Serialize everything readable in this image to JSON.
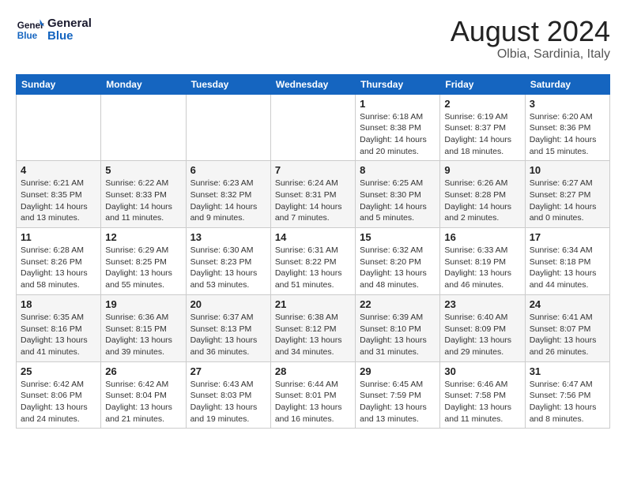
{
  "header": {
    "logo_line1": "General",
    "logo_line2": "Blue",
    "main_title": "August 2024",
    "subtitle": "Olbia, Sardinia, Italy"
  },
  "calendar": {
    "columns": [
      "Sunday",
      "Monday",
      "Tuesday",
      "Wednesday",
      "Thursday",
      "Friday",
      "Saturday"
    ],
    "rows": [
      [
        {
          "day": "",
          "info": ""
        },
        {
          "day": "",
          "info": ""
        },
        {
          "day": "",
          "info": ""
        },
        {
          "day": "",
          "info": ""
        },
        {
          "day": "1",
          "info": "Sunrise: 6:18 AM\nSunset: 8:38 PM\nDaylight: 14 hours and 20 minutes."
        },
        {
          "day": "2",
          "info": "Sunrise: 6:19 AM\nSunset: 8:37 PM\nDaylight: 14 hours and 18 minutes."
        },
        {
          "day": "3",
          "info": "Sunrise: 6:20 AM\nSunset: 8:36 PM\nDaylight: 14 hours and 15 minutes."
        }
      ],
      [
        {
          "day": "4",
          "info": "Sunrise: 6:21 AM\nSunset: 8:35 PM\nDaylight: 14 hours and 13 minutes."
        },
        {
          "day": "5",
          "info": "Sunrise: 6:22 AM\nSunset: 8:33 PM\nDaylight: 14 hours and 11 minutes."
        },
        {
          "day": "6",
          "info": "Sunrise: 6:23 AM\nSunset: 8:32 PM\nDaylight: 14 hours and 9 minutes."
        },
        {
          "day": "7",
          "info": "Sunrise: 6:24 AM\nSunset: 8:31 PM\nDaylight: 14 hours and 7 minutes."
        },
        {
          "day": "8",
          "info": "Sunrise: 6:25 AM\nSunset: 8:30 PM\nDaylight: 14 hours and 5 minutes."
        },
        {
          "day": "9",
          "info": "Sunrise: 6:26 AM\nSunset: 8:28 PM\nDaylight: 14 hours and 2 minutes."
        },
        {
          "day": "10",
          "info": "Sunrise: 6:27 AM\nSunset: 8:27 PM\nDaylight: 14 hours and 0 minutes."
        }
      ],
      [
        {
          "day": "11",
          "info": "Sunrise: 6:28 AM\nSunset: 8:26 PM\nDaylight: 13 hours and 58 minutes."
        },
        {
          "day": "12",
          "info": "Sunrise: 6:29 AM\nSunset: 8:25 PM\nDaylight: 13 hours and 55 minutes."
        },
        {
          "day": "13",
          "info": "Sunrise: 6:30 AM\nSunset: 8:23 PM\nDaylight: 13 hours and 53 minutes."
        },
        {
          "day": "14",
          "info": "Sunrise: 6:31 AM\nSunset: 8:22 PM\nDaylight: 13 hours and 51 minutes."
        },
        {
          "day": "15",
          "info": "Sunrise: 6:32 AM\nSunset: 8:20 PM\nDaylight: 13 hours and 48 minutes."
        },
        {
          "day": "16",
          "info": "Sunrise: 6:33 AM\nSunset: 8:19 PM\nDaylight: 13 hours and 46 minutes."
        },
        {
          "day": "17",
          "info": "Sunrise: 6:34 AM\nSunset: 8:18 PM\nDaylight: 13 hours and 44 minutes."
        }
      ],
      [
        {
          "day": "18",
          "info": "Sunrise: 6:35 AM\nSunset: 8:16 PM\nDaylight: 13 hours and 41 minutes."
        },
        {
          "day": "19",
          "info": "Sunrise: 6:36 AM\nSunset: 8:15 PM\nDaylight: 13 hours and 39 minutes."
        },
        {
          "day": "20",
          "info": "Sunrise: 6:37 AM\nSunset: 8:13 PM\nDaylight: 13 hours and 36 minutes."
        },
        {
          "day": "21",
          "info": "Sunrise: 6:38 AM\nSunset: 8:12 PM\nDaylight: 13 hours and 34 minutes."
        },
        {
          "day": "22",
          "info": "Sunrise: 6:39 AM\nSunset: 8:10 PM\nDaylight: 13 hours and 31 minutes."
        },
        {
          "day": "23",
          "info": "Sunrise: 6:40 AM\nSunset: 8:09 PM\nDaylight: 13 hours and 29 minutes."
        },
        {
          "day": "24",
          "info": "Sunrise: 6:41 AM\nSunset: 8:07 PM\nDaylight: 13 hours and 26 minutes."
        }
      ],
      [
        {
          "day": "25",
          "info": "Sunrise: 6:42 AM\nSunset: 8:06 PM\nDaylight: 13 hours and 24 minutes."
        },
        {
          "day": "26",
          "info": "Sunrise: 6:42 AM\nSunset: 8:04 PM\nDaylight: 13 hours and 21 minutes."
        },
        {
          "day": "27",
          "info": "Sunrise: 6:43 AM\nSunset: 8:03 PM\nDaylight: 13 hours and 19 minutes."
        },
        {
          "day": "28",
          "info": "Sunrise: 6:44 AM\nSunset: 8:01 PM\nDaylight: 13 hours and 16 minutes."
        },
        {
          "day": "29",
          "info": "Sunrise: 6:45 AM\nSunset: 7:59 PM\nDaylight: 13 hours and 13 minutes."
        },
        {
          "day": "30",
          "info": "Sunrise: 6:46 AM\nSunset: 7:58 PM\nDaylight: 13 hours and 11 minutes."
        },
        {
          "day": "31",
          "info": "Sunrise: 6:47 AM\nSunset: 7:56 PM\nDaylight: 13 hours and 8 minutes."
        }
      ]
    ]
  }
}
